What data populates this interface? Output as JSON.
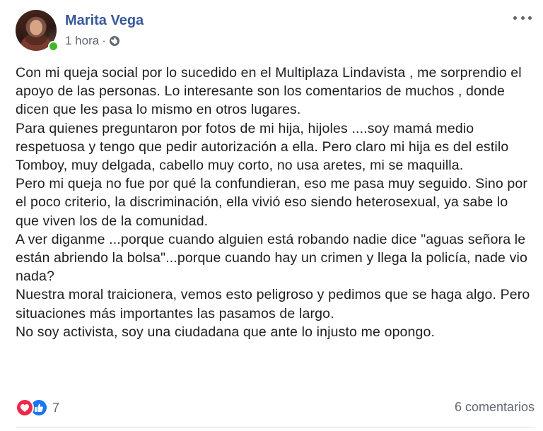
{
  "post": {
    "author": "Marita Vega",
    "timestamp": "1 hora",
    "separator": "·",
    "privacy_icon": "globe-icon",
    "paragraphs": [
      "Con mi queja social por lo sucedido en el Multiplaza Lindavista , me sorprendio el apoyo de las personas. Lo interesante son los comentarios de muchos , donde dicen que les pasa lo mismo en otros lugares.",
      "Para quienes preguntaron por fotos de mi hija, hijoles ....soy mamá medio respetuosa y tengo que pedir autorización a ella. Pero claro mi hija es del estilo Tomboy, muy delgada, cabello muy corto, no usa aretes, mi se maquilla.",
      "Pero mi queja no fue por qué la confundieran, eso me pasa muy seguido. Sino por el poco criterio, la discriminación, ella vivió eso siendo heterosexual, ya sabe lo que viven los de la comunidad.",
      "A ver diganme ...porque cuando alguien está robando nadie dice \"aguas señora le están abriendo la bolsa\"...porque cuando hay un crimen y llega la policía, nade vio nada?",
      "Nuestra moral traicionera, vemos esto peligroso y pedimos que se haga algo. Pero situaciones más importantes las pasamos de largo.",
      "No soy activista, soy una ciudadana que ante lo injusto me opongo."
    ],
    "reactions": {
      "icons": [
        "love-icon",
        "like-icon"
      ],
      "count": "7",
      "love_color": "#f0284a",
      "like_color": "#1877f2"
    },
    "comments_label": "6 comentarios",
    "online": true
  },
  "colors": {
    "name": "#385898",
    "meta": "#616770",
    "text": "#1c1e21",
    "online": "#42b72a"
  }
}
